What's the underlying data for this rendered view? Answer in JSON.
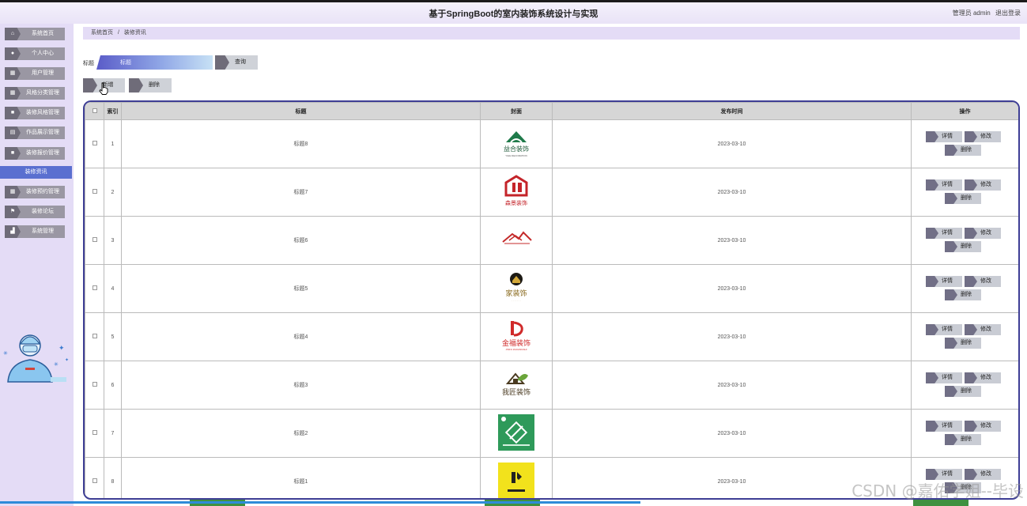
{
  "header": {
    "title": "基于SpringBoot的室内装饰系统设计与实现",
    "user_label": "管理员 admin",
    "logout": "退出登录"
  },
  "sidebar": {
    "items": [
      {
        "label": "系统首页",
        "icon": "home-icon"
      },
      {
        "label": "个人中心",
        "icon": "user-icon"
      },
      {
        "label": "用户管理",
        "icon": "grid-icon"
      },
      {
        "label": "风格分类管理",
        "icon": "grid-icon"
      },
      {
        "label": "装修风格管理",
        "icon": "tag-icon"
      },
      {
        "label": "作品展示管理",
        "icon": "doc-icon"
      },
      {
        "label": "装修报价管理",
        "icon": "tag-icon"
      },
      {
        "label": "装修资讯",
        "icon": "none",
        "active": true
      },
      {
        "label": "装修预约管理",
        "icon": "grid-icon"
      },
      {
        "label": "装修论坛",
        "icon": "flag-icon"
      },
      {
        "label": "系统管理",
        "icon": "chart-icon"
      }
    ]
  },
  "breadcrumb": {
    "home": "系统首页",
    "separator": "/",
    "current": "装修资讯"
  },
  "search": {
    "label": "标题",
    "placeholder": "标题",
    "button": "查询"
  },
  "actions": {
    "add": "新增",
    "delete": "删除"
  },
  "table": {
    "columns": [
      "",
      "索引",
      "标题",
      "封面",
      "发布时间",
      "操作"
    ],
    "rows": [
      {
        "index": "1",
        "title": "标题8",
        "date": "2023-03-10",
        "cover": "yihe-logo"
      },
      {
        "index": "2",
        "title": "标题7",
        "date": "2023-03-10",
        "cover": "house-red-logo"
      },
      {
        "index": "3",
        "title": "标题6",
        "date": "2023-03-10",
        "cover": "roof-red-logo"
      },
      {
        "index": "4",
        "title": "标题5",
        "date": "2023-03-10",
        "cover": "gold-home-logo"
      },
      {
        "index": "5",
        "title": "标题4",
        "date": "2023-03-10",
        "cover": "red-d-logo"
      },
      {
        "index": "6",
        "title": "标题3",
        "date": "2023-03-10",
        "cover": "leaf-house-logo"
      },
      {
        "index": "7",
        "title": "标题2",
        "date": "2023-03-10",
        "cover": "green-tools-logo"
      },
      {
        "index": "8",
        "title": "标题1",
        "date": "2023-03-10",
        "cover": "yellow-logo"
      }
    ],
    "op_labels": {
      "detail": "详情",
      "edit": "修改",
      "delete": "删除"
    }
  },
  "watermark": "CSDN @嘉佑学姐--毕设",
  "colors": {
    "sidebar": "#e4dcf6",
    "active": "#5a6fd0",
    "border": "#3e3e95"
  }
}
